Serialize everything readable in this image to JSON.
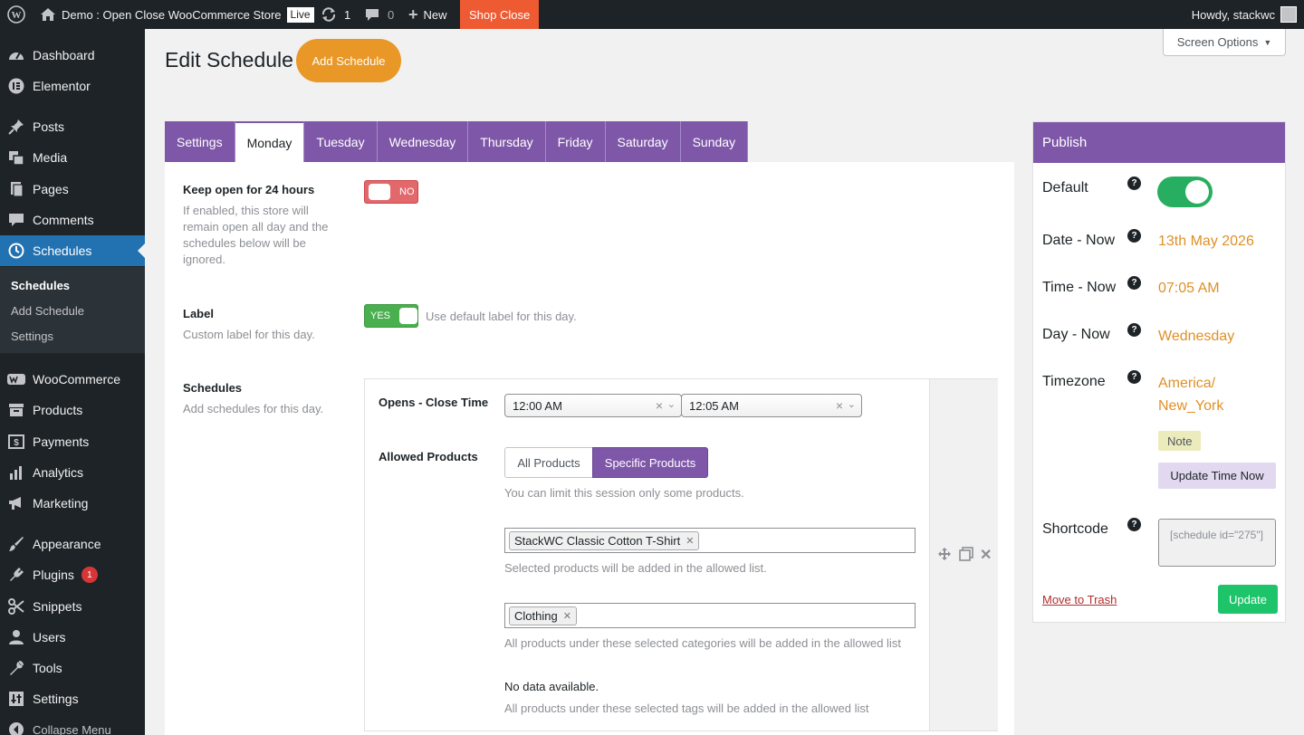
{
  "admin_bar": {
    "site_name": "Demo : Open Close WooCommerce Store",
    "live_badge": "Live",
    "updates_count": "1",
    "comments_count": "0",
    "new_label": "New",
    "shop_status": "Shop Close",
    "greeting": "Howdy, stackwc"
  },
  "sidebar": {
    "items": [
      {
        "label": "Dashboard",
        "icon": "dashboard-icon"
      },
      {
        "label": "Elementor",
        "icon": "elementor-icon"
      },
      {
        "label": "Posts",
        "icon": "pin-icon"
      },
      {
        "label": "Media",
        "icon": "media-icon"
      },
      {
        "label": "Pages",
        "icon": "pages-icon"
      },
      {
        "label": "Comments",
        "icon": "comment-icon"
      },
      {
        "label": "Schedules",
        "icon": "clock-icon",
        "current": true
      },
      {
        "label": "WooCommerce",
        "icon": "woocommerce-icon"
      },
      {
        "label": "Products",
        "icon": "archive-icon"
      },
      {
        "label": "Payments",
        "icon": "dollar-icon"
      },
      {
        "label": "Analytics",
        "icon": "bar-chart-icon"
      },
      {
        "label": "Marketing",
        "icon": "megaphone-icon"
      },
      {
        "label": "Appearance",
        "icon": "brush-icon"
      },
      {
        "label": "Plugins",
        "icon": "plug-icon",
        "badge": "1"
      },
      {
        "label": "Snippets",
        "icon": "scissors-icon"
      },
      {
        "label": "Users",
        "icon": "user-icon"
      },
      {
        "label": "Tools",
        "icon": "wrench-icon"
      },
      {
        "label": "Settings",
        "icon": "settings-icon"
      },
      {
        "label": "Collapse Menu",
        "icon": "collapse-icon"
      }
    ],
    "submenu": [
      {
        "label": "Schedules",
        "current": true
      },
      {
        "label": "Add Schedule"
      },
      {
        "label": "Settings"
      }
    ]
  },
  "header": {
    "title": "Edit Schedule",
    "add_button": "Add Schedule",
    "screen_options": "Screen Options"
  },
  "tabs": [
    {
      "label": "Settings"
    },
    {
      "label": "Monday",
      "active": true
    },
    {
      "label": "Tuesday"
    },
    {
      "label": "Wednesday"
    },
    {
      "label": "Thursday"
    },
    {
      "label": "Friday"
    },
    {
      "label": "Saturday"
    },
    {
      "label": "Sunday"
    }
  ],
  "form": {
    "keep_open": {
      "label": "Keep open for 24 hours",
      "description": "If enabled, this store will remain open all day and the schedules below will be ignored.",
      "toggle_text": "NO",
      "enabled": false
    },
    "label": {
      "label": "Label",
      "description": "Custom label for this day.",
      "toggle_text": "YES",
      "enabled": true,
      "hint": "Use default label for this day."
    },
    "schedules": {
      "label": "Schedules",
      "description": "Add schedules for this day.",
      "time_label": "Opens - Close Time",
      "open_time": "12:00 AM",
      "close_time": "12:05 AM",
      "products_label": "Allowed Products",
      "segment_all": "All Products",
      "segment_specific": "Specific Products",
      "segment_selected": "Specific Products",
      "segment_hint": "You can limit this session only some products.",
      "product_tag": "StackWC Classic Cotton T-Shirt",
      "product_hint": "Selected products will be added in the allowed list.",
      "category_tag": "Clothing",
      "category_hint": "All products under these selected categories will be added in the allowed list",
      "tags_empty": "No data available.",
      "tags_hint": "All products under these selected tags will be added in the allowed list"
    }
  },
  "publish": {
    "title": "Publish",
    "default_label": "Default",
    "default_enabled": true,
    "date_label": "Date - Now",
    "date_value": "13th May 2026",
    "time_label": "Time - Now",
    "time_value": "07:05 AM",
    "day_label": "Day - Now",
    "day_value": "Wednesday",
    "timezone_label": "Timezone",
    "timezone_value_1": "America/",
    "timezone_value_2": "New_York",
    "note_button": "Note",
    "update_time_button": "Update Time Now",
    "shortcode_label": "Shortcode",
    "shortcode_value": "[schedule id=\"275\"]",
    "trash_link": "Move to Trash",
    "update_button": "Update"
  },
  "colors": {
    "accent": "#7e57a8",
    "orange": "#e99726",
    "admin_dark": "#1d2327",
    "wp_blue": "#2271b1",
    "toggle_off": "#e2686c",
    "toggle_on": "#4ab04f",
    "switch_on": "#27ae60",
    "update_green": "#1ec46a",
    "shop_close": "#ee5b33"
  }
}
